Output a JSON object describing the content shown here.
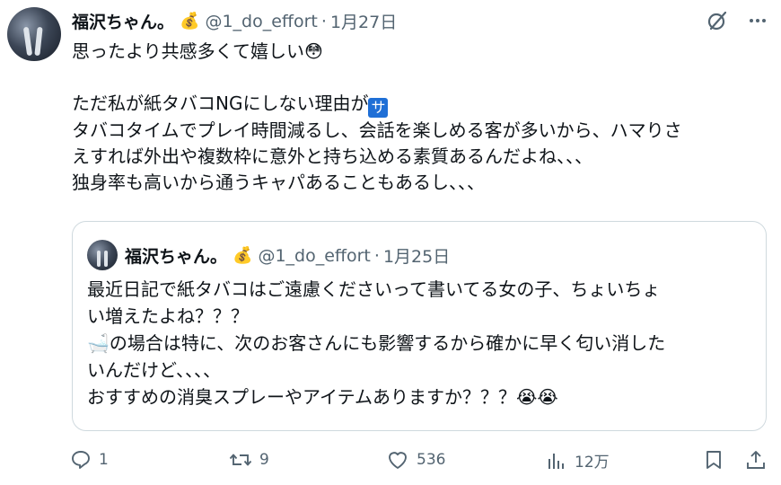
{
  "tweet": {
    "author_name": "福沢ちゃん。",
    "author_badge": "💰",
    "handle": "@1_do_effort",
    "separator": "·",
    "date": "1月27日",
    "lines": [
      "思ったより共感多くて嬉しい😳",
      "",
      "ただ私が紙タバコNGにしない理由が",
      "タバコタイムでプレイ時間減るし、会話を楽しめる客が多いから、ハマりさ",
      "えすれば外出や複数枠に意外と持ち込める素質あるんだよね、、、",
      "独身率も高いから通うキャパあることもあるし、、、"
    ],
    "badge_text": "サ"
  },
  "quote": {
    "author_name": "福沢ちゃん。",
    "author_badge": "💰",
    "handle": "@1_do_effort",
    "separator": "·",
    "date": "1月25日",
    "lines": [
      "最近日記で紙タバコはご遠慮くださいって書いてる女の子、ちょいちょ",
      "い増えたよね？？？",
      "🛁の場合は特に、次のお客さんにも影響するから確かに早く匂い消した",
      "いんだけど、、、、",
      "おすすめの消臭スプレーやアイテムありますか？？？😭😭"
    ]
  },
  "actions": {
    "replies": "1",
    "retweets": "9",
    "likes": "536",
    "views": "12万"
  },
  "icons": {
    "top": [
      "grok-icon",
      "more-icon"
    ],
    "actions": [
      "reply-icon",
      "retweet-icon",
      "like-icon",
      "views-icon",
      "bookmark-icon",
      "share-icon"
    ]
  }
}
